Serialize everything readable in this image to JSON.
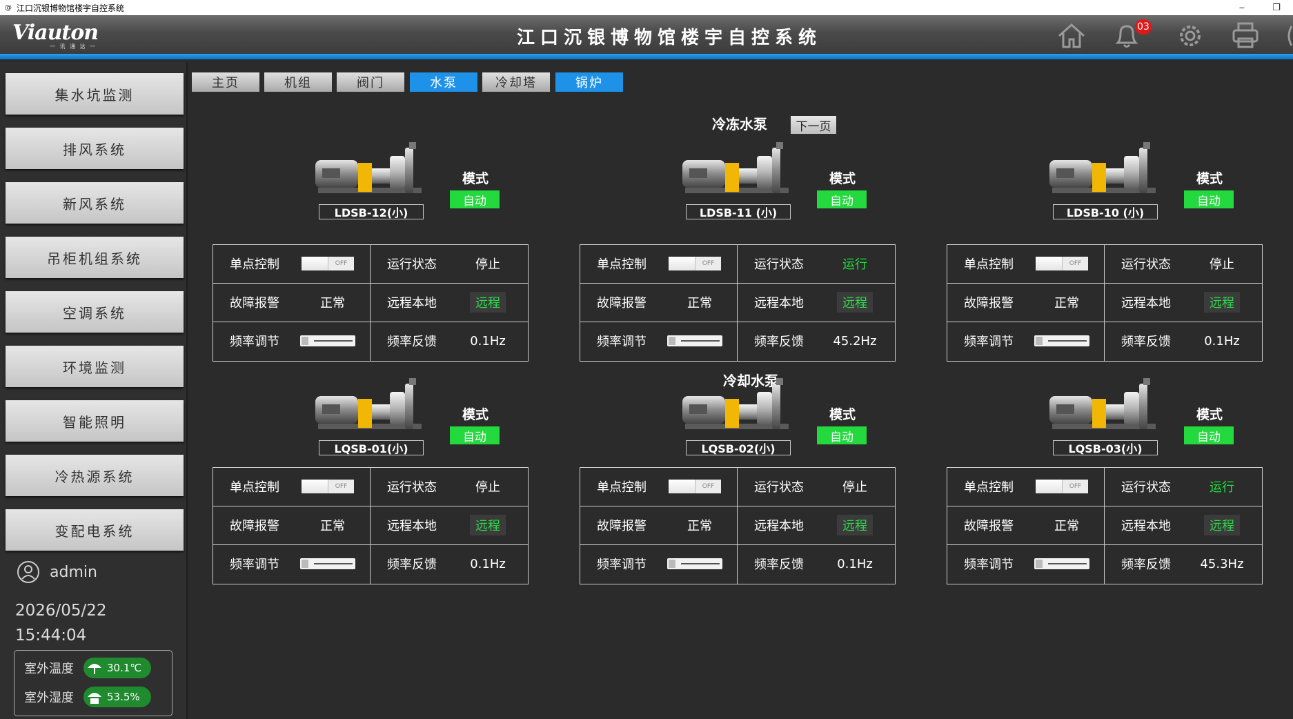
{
  "window": {
    "title": "江口沉银博物馆楼宇自控系统",
    "minimize": "‒",
    "restore": "❐"
  },
  "header": {
    "logo": "Viauton",
    "logo_sub": "一 讯 通 达 一",
    "title": "江口沉银博物馆楼宇自控系统",
    "alarm_count": "03"
  },
  "sidebar": {
    "items": [
      "集水坑监测",
      "排风系统",
      "新风系统",
      "吊柜机组系统",
      "空调系统",
      "环境监测",
      "智能照明",
      "冷热源系统",
      "变配电系统"
    ],
    "user": "admin",
    "date": "2026/05/22",
    "time": "15:44:04",
    "weather": {
      "temp_label": "室外温度",
      "temp_value": "30.1℃",
      "hum_label": "室外湿度",
      "hum_value": "53.5%"
    }
  },
  "tabs": [
    {
      "label": "主页",
      "active": false
    },
    {
      "label": "机组",
      "active": false
    },
    {
      "label": "阀门",
      "active": false
    },
    {
      "label": "水泵",
      "active": true
    },
    {
      "label": "冷却塔",
      "active": false
    },
    {
      "label": "锅炉",
      "active": true
    }
  ],
  "sections": {
    "chilled": "冷冻水泵",
    "cooling": "冷却水泵",
    "next_page": "下一页"
  },
  "labels": {
    "mode": "模式",
    "single": "单点控制",
    "run_state": "运行状态",
    "fault": "故障报警",
    "remote_local": "远程本地",
    "freq_adj": "频率调节",
    "freq_fb": "频率反馈",
    "off": "OFF"
  },
  "pumps": [
    {
      "name": "LDSB-12(小)",
      "mode": "自动",
      "state": "停止",
      "fault": "正常",
      "remote": "远程",
      "freq": "0.1Hz",
      "slider": 0.12
    },
    {
      "name": "LDSB-11 (小)",
      "mode": "自动",
      "state": "运行",
      "fault": "正常",
      "remote": "远程",
      "freq": "45.2Hz",
      "slider": 0.12
    },
    {
      "name": "LDSB-10 (小)",
      "mode": "自动",
      "state": "停止",
      "fault": "正常",
      "remote": "远程",
      "freq": "0.1Hz",
      "slider": 0.12
    },
    {
      "name": "LQSB-01(小)",
      "mode": "自动",
      "state": "停止",
      "fault": "正常",
      "remote": "远程",
      "freq": "0.1Hz",
      "slider": 0.12
    },
    {
      "name": "LQSB-02(小)",
      "mode": "自动",
      "state": "停止",
      "fault": "正常",
      "remote": "远程",
      "freq": "0.1Hz",
      "slider": 0.12
    },
    {
      "name": "LQSB-03(小)",
      "mode": "自动",
      "state": "运行",
      "fault": "正常",
      "remote": "远程",
      "freq": "45.3Hz",
      "slider": 0.12
    }
  ]
}
